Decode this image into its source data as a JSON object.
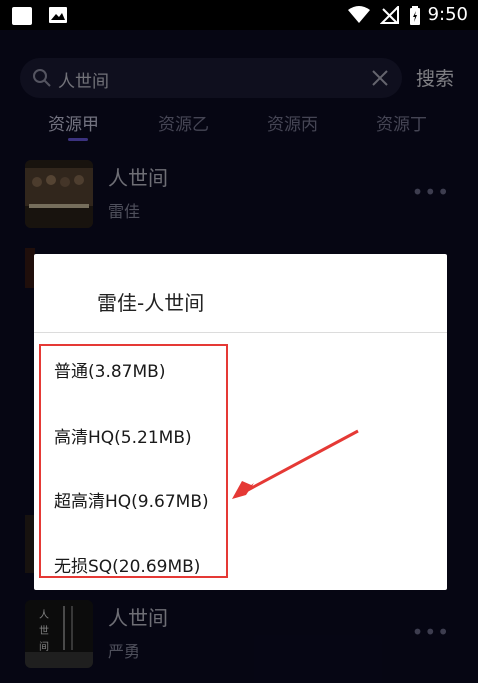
{
  "status_bar": {
    "time": "9:50"
  },
  "search": {
    "query": "人世间",
    "button_label": "搜索"
  },
  "tabs": [
    "资源甲",
    "资源乙",
    "资源丙",
    "资源丁"
  ],
  "songs": [
    {
      "title": "人世间",
      "artist": "雷佳"
    },
    {
      "title": "人世间",
      "artist": "严勇"
    }
  ],
  "dialog": {
    "title": "雷佳-人世间",
    "options": [
      "普通(3.87MB)",
      "高清HQ(5.21MB)",
      "超高清HQ(9.67MB)",
      "无损SQ(20.69MB)"
    ]
  },
  "colors": {
    "accent": "#6c5ce7",
    "highlight": "#e53935",
    "background": "#0b0b24"
  }
}
